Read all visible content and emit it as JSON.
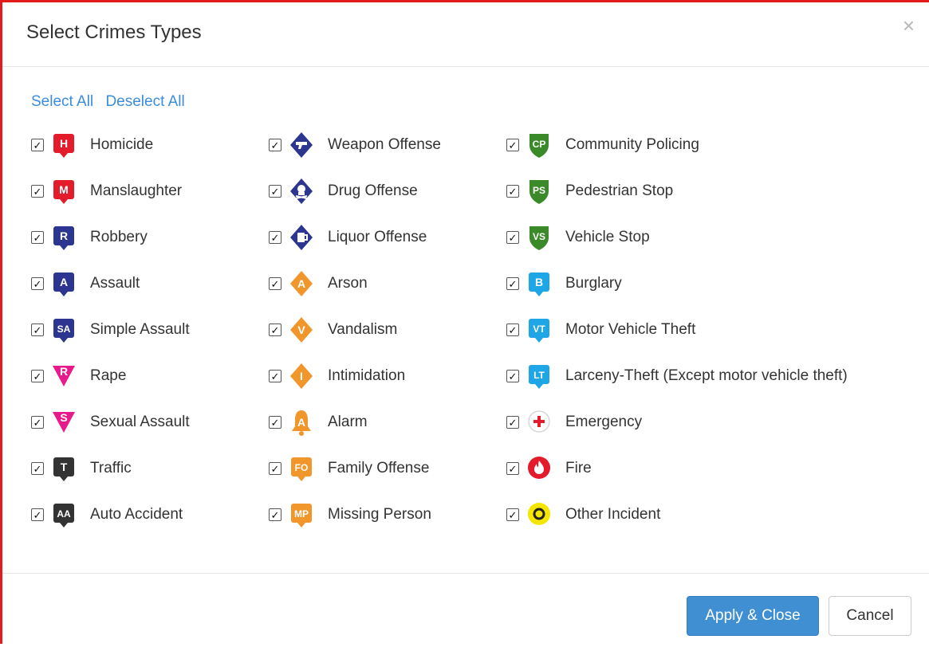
{
  "dialog": {
    "title": "Select Crimes Types",
    "close_glyph": "×",
    "select_all": "Select All",
    "deselect_all": "Deselect All",
    "apply_label": "Apply & Close",
    "cancel_label": "Cancel"
  },
  "columns": [
    [
      {
        "label": "Homicide",
        "checked": true,
        "icon": "homicide-icon",
        "icon_text": "H",
        "shape": "square",
        "color": "#e31b2b"
      },
      {
        "label": "Manslaughter",
        "checked": true,
        "icon": "manslaughter-icon",
        "icon_text": "M",
        "shape": "square",
        "color": "#e31b2b"
      },
      {
        "label": "Robbery",
        "checked": true,
        "icon": "robbery-icon",
        "icon_text": "R",
        "shape": "square",
        "color": "#2c3590"
      },
      {
        "label": "Assault",
        "checked": true,
        "icon": "assault-icon",
        "icon_text": "A",
        "shape": "square",
        "color": "#2c3590"
      },
      {
        "label": "Simple Assault",
        "checked": true,
        "icon": "simple-assault-icon",
        "icon_text": "SA",
        "shape": "square",
        "color": "#2c3590"
      },
      {
        "label": "Rape",
        "checked": true,
        "icon": "rape-icon",
        "icon_text": "R",
        "shape": "triangle",
        "color": "#e8198b"
      },
      {
        "label": "Sexual Assault",
        "checked": true,
        "icon": "sexual-assault-icon",
        "icon_text": "S",
        "shape": "triangle",
        "color": "#e8198b"
      },
      {
        "label": "Traffic",
        "checked": true,
        "icon": "traffic-icon",
        "icon_text": "T",
        "shape": "square",
        "color": "#333333"
      },
      {
        "label": "Auto Accident",
        "checked": true,
        "icon": "auto-accident-icon",
        "icon_text": "AA",
        "shape": "square",
        "color": "#333333"
      }
    ],
    [
      {
        "label": "Weapon Offense",
        "checked": true,
        "icon": "weapon-icon",
        "icon_text": "",
        "glyph": "gun",
        "shape": "diamond",
        "color": "#2c3590"
      },
      {
        "label": "Drug Offense",
        "checked": true,
        "icon": "drug-icon",
        "icon_text": "",
        "glyph": "skull",
        "shape": "diamond",
        "color": "#2c3590"
      },
      {
        "label": "Liquor Offense",
        "checked": true,
        "icon": "liquor-icon",
        "icon_text": "",
        "glyph": "mug",
        "shape": "diamond",
        "color": "#2c3590"
      },
      {
        "label": "Arson",
        "checked": true,
        "icon": "arson-icon",
        "icon_text": "A",
        "shape": "diamond",
        "color": "#f0962a"
      },
      {
        "label": "Vandalism",
        "checked": true,
        "icon": "vandalism-icon",
        "icon_text": "V",
        "shape": "diamond",
        "color": "#f0962a"
      },
      {
        "label": "Intimidation",
        "checked": true,
        "icon": "intimidation-icon",
        "icon_text": "I",
        "shape": "diamond",
        "color": "#f0962a"
      },
      {
        "label": "Alarm",
        "checked": true,
        "icon": "alarm-icon",
        "icon_text": "A",
        "shape": "bell",
        "color": "#f0962a"
      },
      {
        "label": "Family Offense",
        "checked": true,
        "icon": "family-offense-icon",
        "icon_text": "FO",
        "shape": "square",
        "color": "#f0962a"
      },
      {
        "label": "Missing Person",
        "checked": true,
        "icon": "missing-person-icon",
        "icon_text": "MP",
        "shape": "square",
        "color": "#f0962a"
      }
    ],
    [
      {
        "label": "Community Policing",
        "checked": true,
        "icon": "community-policing-icon",
        "icon_text": "CP",
        "shape": "shield",
        "color": "#3a8a2a"
      },
      {
        "label": "Pedestrian Stop",
        "checked": true,
        "icon": "pedestrian-stop-icon",
        "icon_text": "PS",
        "shape": "shield",
        "color": "#3a8a2a"
      },
      {
        "label": "Vehicle Stop",
        "checked": true,
        "icon": "vehicle-stop-icon",
        "icon_text": "VS",
        "shape": "shield",
        "color": "#3a8a2a"
      },
      {
        "label": "Burglary",
        "checked": true,
        "icon": "burglary-icon",
        "icon_text": "B",
        "shape": "square",
        "color": "#1ea6e6"
      },
      {
        "label": "Motor Vehicle Theft",
        "checked": true,
        "icon": "motor-vehicle-theft-icon",
        "icon_text": "VT",
        "shape": "square",
        "color": "#1ea6e6"
      },
      {
        "label": "Larceny-Theft (Except motor vehicle theft)",
        "checked": true,
        "icon": "larceny-theft-icon",
        "icon_text": "LT",
        "shape": "square",
        "color": "#1ea6e6"
      },
      {
        "label": "Emergency",
        "checked": true,
        "icon": "emergency-icon",
        "icon_text": "",
        "glyph": "cross",
        "shape": "circle-white",
        "color": "#e31b2b"
      },
      {
        "label": "Fire",
        "checked": true,
        "icon": "fire-icon",
        "icon_text": "",
        "glyph": "flame",
        "shape": "circle",
        "color": "#e31b2b"
      },
      {
        "label": "Other Incident",
        "checked": true,
        "icon": "other-incident-icon",
        "icon_text": "O",
        "shape": "circle-yellow",
        "color": "#f5e600"
      }
    ]
  ]
}
